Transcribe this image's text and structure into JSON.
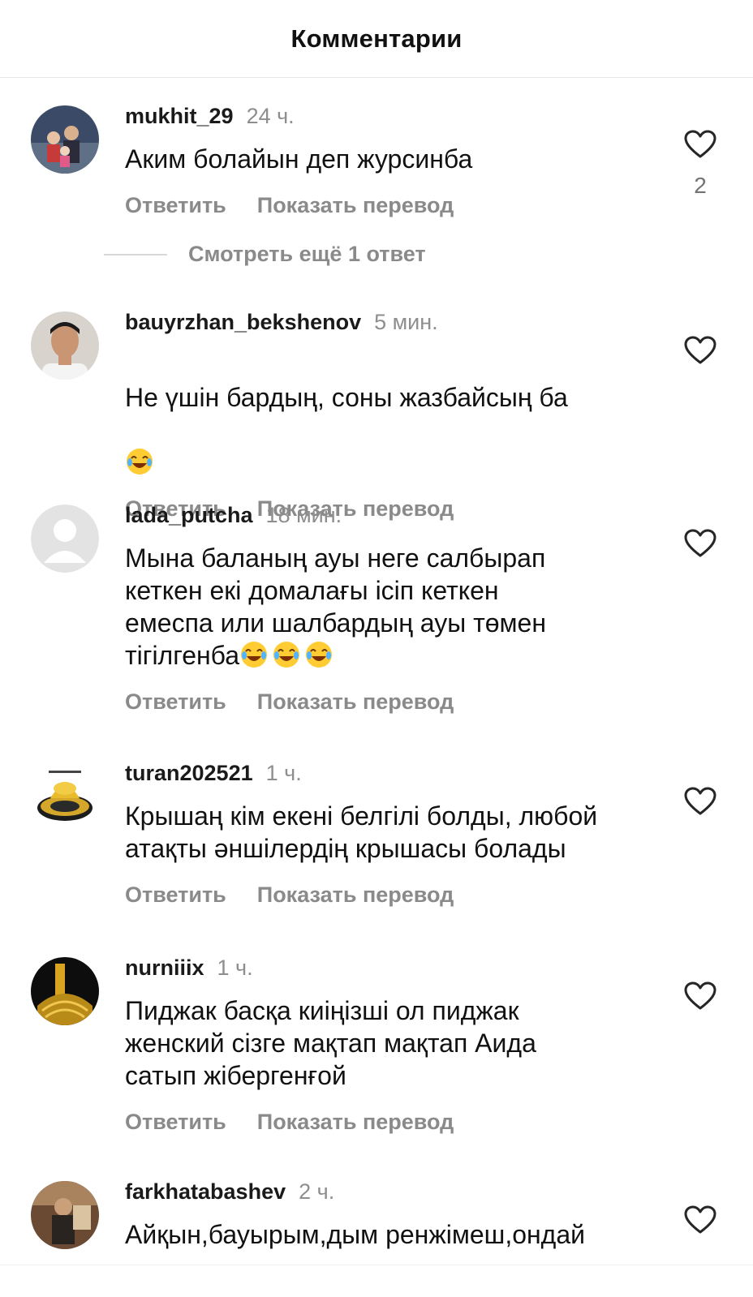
{
  "header": {
    "title": "Комментарии"
  },
  "view_more": {
    "label": "Смотреть ещё 1 ответ"
  },
  "actions": {
    "reply": "Ответить",
    "translate": "Показать перевод"
  },
  "comments": [
    {
      "username": "mukhit_29",
      "time": "24 ч.",
      "text": "Аким болайын деп журсинба",
      "likes": "2",
      "avatar": "family-photo"
    },
    {
      "username": "bauyrzhan_bekshenov",
      "time": "5 мин.",
      "text": "Не үшін бардың, соны жазбайсың ба",
      "emoji_count": 1,
      "likes": "",
      "avatar": "man-portrait"
    },
    {
      "username": "lada_putcha",
      "time": "18 мин.",
      "text": "Мына баланың ауы неге салбырап\nкеткен екі домалағы ісіп кеткен\nемеспа или шалбардың ауы төмен\nтігілгенба",
      "emoji_count": 3,
      "likes": "",
      "avatar": "default-avatar"
    },
    {
      "username": "turan202521",
      "time": "1 ч.",
      "text": "Крышаң кім екені белгілі болды, любой\nатақты әншілердің крышасы болады",
      "likes": "",
      "avatar": "gold-dish"
    },
    {
      "username": "nurniiix",
      "time": "1 ч.",
      "text": "Пиджак басқа киіңізші ол пиджак\nженский сізге мақтап мақтап Аида\nсатып жібергенғой",
      "likes": "",
      "avatar": "gold-ornament"
    },
    {
      "username": "farkhatabashev",
      "time": "2 ч.",
      "text": "Айқын,бауырым,дым ренжімеш,ондай",
      "likes": "",
      "avatar": "person-photo"
    }
  ],
  "colors": {
    "username": "#1a1a1a",
    "muted": "#8a8a8a",
    "text": "#111111"
  }
}
